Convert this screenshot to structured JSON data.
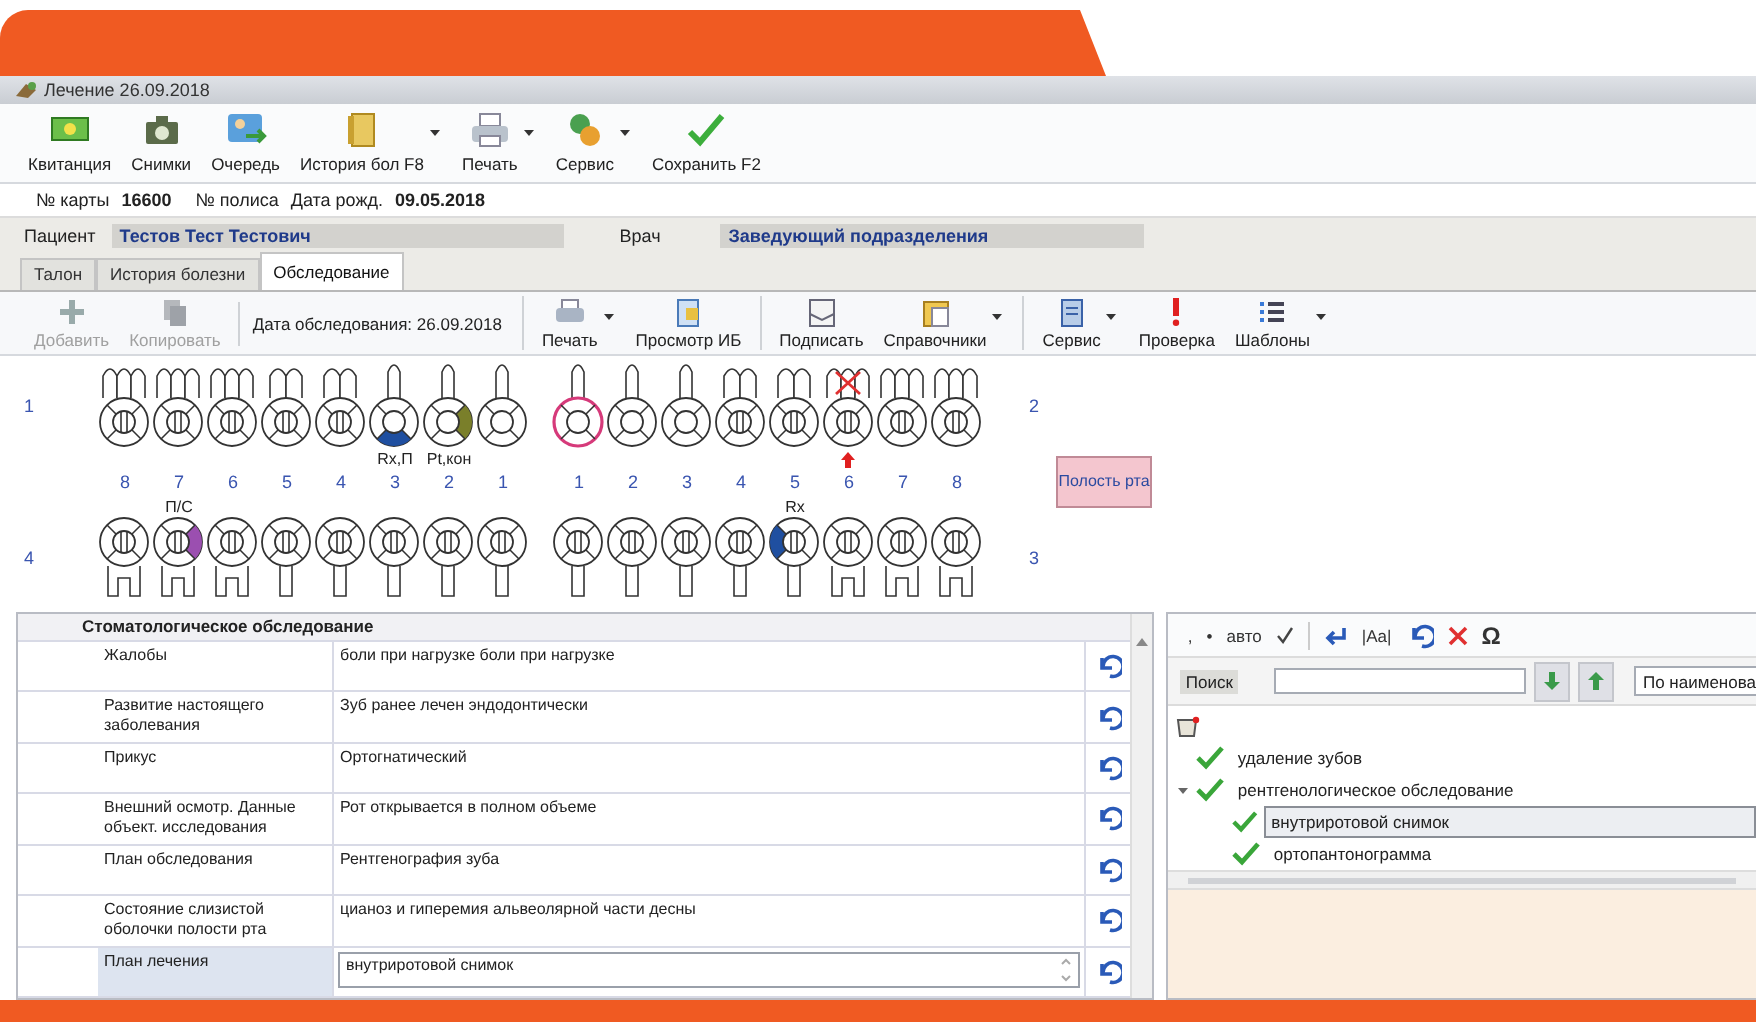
{
  "window": {
    "title": "Лечение 26.09.2018"
  },
  "toolbar": [
    {
      "label": "Квитанция",
      "menu": false
    },
    {
      "label": "Снимки",
      "menu": false
    },
    {
      "label": "Очередь",
      "menu": false
    },
    {
      "label": "История бол F8",
      "menu": true
    },
    {
      "label": "Печать",
      "menu": true
    },
    {
      "label": "Сервис",
      "menu": true
    },
    {
      "label": "Сохранить F2",
      "menu": false
    }
  ],
  "card_info": [
    {
      "label": "№ карты",
      "value": "16600"
    },
    {
      "label": "№ полиса"
    },
    {
      "label": "Дата рожд.",
      "value": "09.05.2018"
    }
  ],
  "patient": {
    "label": "Пациент",
    "name": "Тестов Тест Тестович",
    "doctor_label": "Врач",
    "doctor": "Заведующий подразделения"
  },
  "tabs": [
    {
      "label": "Талон",
      "selected": false
    },
    {
      "label": "История болезни",
      "selected": false
    },
    {
      "label": "Обследование",
      "selected": true
    }
  ],
  "exam_toolbar": [
    {
      "kind": "button",
      "label": "Добавить",
      "disabled": true,
      "menu": false,
      "group_start": false
    },
    {
      "kind": "button",
      "label": "Копировать",
      "disabled": true,
      "menu": false,
      "group_start": false
    },
    {
      "kind": "text",
      "label": "Дата обследования: 26.09.2018",
      "group_start": true
    },
    {
      "kind": "button",
      "label": "Печать",
      "disabled": false,
      "menu": true,
      "group_start": true
    },
    {
      "kind": "button",
      "label": "Просмотр ИБ",
      "disabled": false,
      "menu": false,
      "group_start": false
    },
    {
      "kind": "button",
      "label": "Подписать",
      "disabled": false,
      "menu": false,
      "group_start": true
    },
    {
      "kind": "button",
      "label": "Справочники",
      "disabled": false,
      "menu": true,
      "group_start": false
    },
    {
      "kind": "button",
      "label": "Сервис",
      "disabled": false,
      "menu": true,
      "group_start": true
    },
    {
      "kind": "button",
      "label": "Проверка",
      "disabled": false,
      "menu": false,
      "group_start": false
    },
    {
      "kind": "button",
      "label": "Шаблоны",
      "disabled": false,
      "menu": true,
      "group_start": false
    }
  ],
  "dental_chart": {
    "quadrants": [
      "1",
      "2",
      "4",
      "3"
    ],
    "numbers": [
      "8",
      "7",
      "6",
      "5",
      "4",
      "3",
      "2",
      "1",
      "1",
      "2",
      "3",
      "4",
      "5",
      "6",
      "7",
      "8"
    ],
    "upper": [
      {
        "kind": "molar",
        "selected": false,
        "crossed": false,
        "flagged": false
      },
      {
        "kind": "molar",
        "selected": false,
        "crossed": false,
        "flagged": false
      },
      {
        "kind": "molar",
        "selected": false,
        "crossed": false,
        "flagged": false
      },
      {
        "kind": "premolar",
        "selected": false,
        "crossed": false,
        "flagged": false
      },
      {
        "kind": "premolar",
        "selected": false,
        "crossed": false,
        "flagged": false
      },
      {
        "kind": "incisor",
        "selected": false,
        "crossed": false,
        "flagged": false,
        "filling": {
          "kind": "bottom",
          "color": "#1f4fa0"
        },
        "label": "Rx,П"
      },
      {
        "kind": "incisor",
        "selected": false,
        "crossed": false,
        "flagged": false,
        "filling": {
          "kind": "right",
          "color": "#7a7f2a"
        },
        "label": "Pt,кон"
      },
      {
        "kind": "incisor",
        "selected": false,
        "crossed": false,
        "flagged": false
      },
      {
        "kind": "incisor",
        "selected": true,
        "crossed": false,
        "flagged": false
      },
      {
        "kind": "incisor",
        "selected": false,
        "crossed": false,
        "flagged": false
      },
      {
        "kind": "incisor",
        "selected": false,
        "crossed": false,
        "flagged": false
      },
      {
        "kind": "premolar",
        "selected": false,
        "crossed": false,
        "flagged": false
      },
      {
        "kind": "premolar",
        "selected": false,
        "crossed": false,
        "flagged": false
      },
      {
        "kind": "molar",
        "selected": false,
        "crossed": true,
        "flagged": true
      },
      {
        "kind": "molar",
        "selected": false,
        "crossed": false,
        "flagged": false
      },
      {
        "kind": "molar",
        "selected": false,
        "crossed": false,
        "flagged": false
      }
    ],
    "lower": [
      {
        "kind": "molar",
        "selected": false,
        "crossed": false
      },
      {
        "kind": "molar",
        "selected": false,
        "crossed": false,
        "filling": {
          "kind": "right",
          "color": "#9b4fb0"
        },
        "label": "П/С"
      },
      {
        "kind": "molar",
        "selected": false,
        "crossed": false
      },
      {
        "kind": "incisor",
        "selected": false,
        "crossed": false
      },
      {
        "kind": "incisor",
        "selected": false,
        "crossed": false
      },
      {
        "kind": "incisor",
        "selected": false,
        "crossed": false
      },
      {
        "kind": "incisor",
        "selected": false,
        "crossed": false
      },
      {
        "kind": "incisor",
        "selected": false,
        "crossed": false
      },
      {
        "kind": "incisor",
        "selected": false,
        "crossed": false
      },
      {
        "kind": "incisor",
        "selected": false,
        "crossed": false
      },
      {
        "kind": "incisor",
        "selected": false,
        "crossed": false
      },
      {
        "kind": "incisor",
        "selected": false,
        "crossed": false
      },
      {
        "kind": "incisor",
        "selected": false,
        "crossed": false,
        "filling": {
          "kind": "left",
          "color": "#1f4fa0"
        },
        "label": "Rx"
      },
      {
        "kind": "molar",
        "selected": false,
        "crossed": false
      },
      {
        "kind": "molar",
        "selected": false,
        "crossed": false
      },
      {
        "kind": "molar",
        "selected": false,
        "crossed": false
      }
    ],
    "oral_cavity_button": "Полость рта"
  },
  "exam_form": {
    "title": "Стоматологическое обследование",
    "rows": [
      {
        "label": "Жалобы",
        "value": "боли при нагрузке боли при нагрузке",
        "selected": false
      },
      {
        "label": "Развитие настоящего заболевания",
        "value": "Зуб ранее лечен эндодонтически",
        "selected": false
      },
      {
        "label": "Прикус",
        "value": "Ортогнатический",
        "selected": false
      },
      {
        "label": "Внешний осмотр. Данные объект. исследования",
        "value": "Рот открывается в полном объеме",
        "selected": false
      },
      {
        "label": "План обследования",
        "value": "Рентгенография зуба",
        "selected": false
      },
      {
        "label": "Состояние слизистой оболочки полости рта",
        "value": "цианоз и гиперемия альвеолярной части десны",
        "selected": false
      },
      {
        "label": "План лечения",
        "value": "внутриротовой снимок",
        "selected": true
      }
    ]
  },
  "text_toolbar": [
    {
      "kind": "glyph",
      "label": ","
    },
    {
      "kind": "glyph",
      "label": "•"
    },
    {
      "kind": "glyph",
      "label": "авто"
    },
    {
      "kind": "check"
    },
    {
      "kind": "enter"
    },
    {
      "kind": "glyph",
      "label": "|Aa|"
    },
    {
      "kind": "undo"
    },
    {
      "kind": "delete"
    },
    {
      "kind": "glyph",
      "label": "Ω"
    }
  ],
  "search": {
    "label": "Поиск",
    "sort": "По наименова"
  },
  "tree": [
    {
      "label": "удаление зубов",
      "checked": true,
      "selected": false
    },
    {
      "label": "рентгенологическое обследование",
      "checked": true,
      "selected": false,
      "expanded": true,
      "children": [
        {
          "label": "внутриротовой снимок",
          "checked": true,
          "selected": true
        },
        {
          "label": "ортопантонограмма",
          "checked": true,
          "selected": false
        }
      ]
    }
  ]
}
